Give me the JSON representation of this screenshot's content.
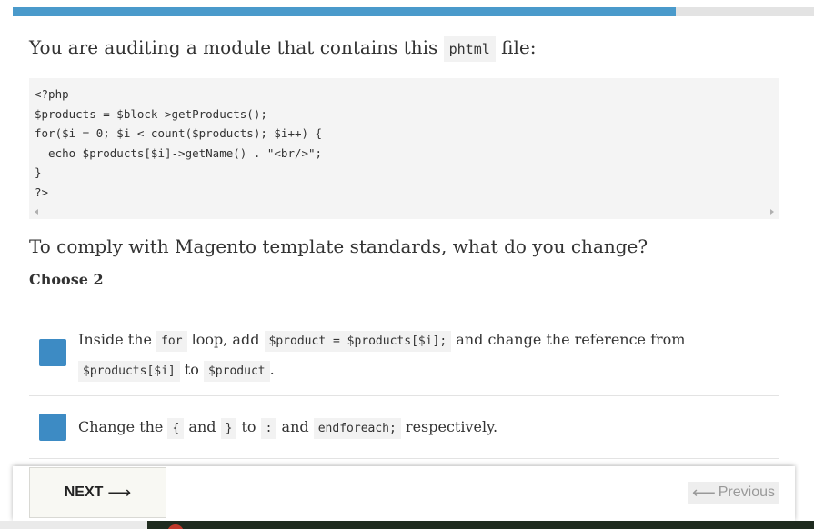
{
  "progress": {
    "fraction": 0.827,
    "fill_color": "#4a9acb",
    "track_color": "#e3e3e3"
  },
  "question": {
    "prefix": "You are auditing a module that contains this",
    "code_word": "phtml",
    "suffix": "file:"
  },
  "code_lines": [
    "<?php",
    "$products = $block->getProducts();",
    "for($i = 0; $i < count($products); $i++) {",
    "  echo $products[$i]->getName() . \"<br/>\";",
    "}",
    "?>"
  ],
  "prompt": "To comply with Magento template standards, what do you change?",
  "choose": "Choose 2",
  "options": [
    {
      "parts": [
        {
          "t": "text",
          "v": "Inside the "
        },
        {
          "t": "code",
          "v": "for"
        },
        {
          "t": "text",
          "v": " loop, add "
        },
        {
          "t": "code",
          "v": "$product = $products[$i];"
        },
        {
          "t": "text",
          "v": " and change the reference from "
        },
        {
          "t": "code",
          "v": "$products[$i]"
        },
        {
          "t": "text",
          "v": " to "
        },
        {
          "t": "code",
          "v": "$product"
        },
        {
          "t": "text",
          "v": "."
        }
      ]
    },
    {
      "parts": [
        {
          "t": "text",
          "v": "Change the "
        },
        {
          "t": "code",
          "v": "{"
        },
        {
          "t": "text",
          "v": " and "
        },
        {
          "t": "code",
          "v": "}"
        },
        {
          "t": "text",
          "v": " to "
        },
        {
          "t": "code",
          "v": ":"
        },
        {
          "t": "text",
          "v": " and "
        },
        {
          "t": "code",
          "v": "endforeach;"
        },
        {
          "t": "text",
          "v": " respectively."
        }
      ]
    }
  ],
  "checkbox_color": "#3d8bc4",
  "footer": {
    "next_label": "NEXT",
    "next_icon": "long-arrow-right-icon",
    "previous_label": "Previous",
    "previous_icon": "long-arrow-left-icon"
  }
}
